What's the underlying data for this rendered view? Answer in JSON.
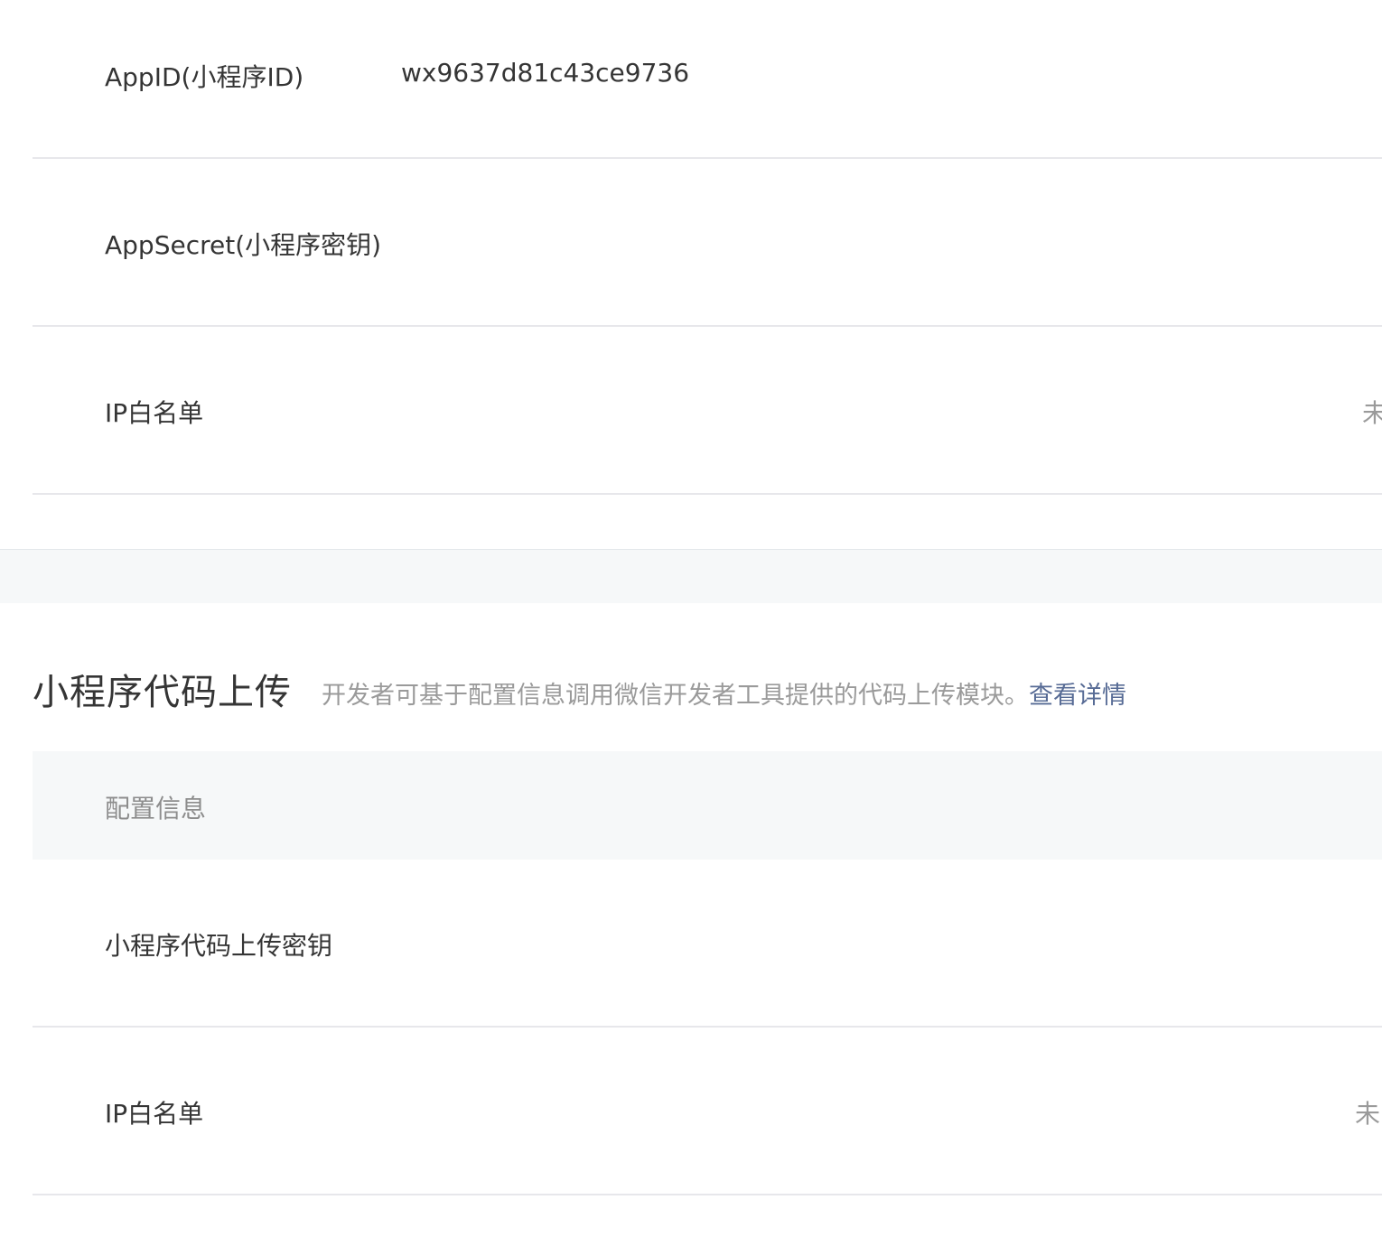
{
  "dev_settings": {
    "rows": [
      {
        "label": "AppID(小程序ID)",
        "value": "wx9637d81c43ce9736"
      },
      {
        "label": "AppSecret(小程序密钥)",
        "value": ""
      },
      {
        "label": "IP白名单",
        "status": "未"
      }
    ]
  },
  "code_upload": {
    "title": "小程序代码上传",
    "description": "开发者可基于配置信息调用微信开发者工具提供的代码上传模块。",
    "link_text": "查看详情",
    "table_header": "配置信息",
    "rows": [
      {
        "label": "小程序代码上传密钥"
      },
      {
        "label": "IP白名单",
        "status": "未"
      }
    ]
  },
  "colors": {
    "link": "#576b95",
    "muted_text": "#9a9a9a",
    "divider": "#e7e7eb",
    "gap_background": "#f6f8f9"
  }
}
